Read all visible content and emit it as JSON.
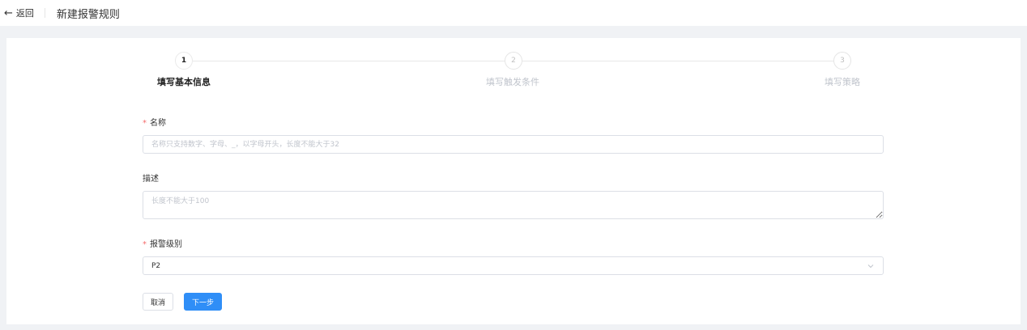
{
  "topbar": {
    "back_label": "返回",
    "title": "新建报警规则"
  },
  "steps": [
    {
      "number": "1",
      "label": "填写基本信息"
    },
    {
      "number": "2",
      "label": "填写触发条件"
    },
    {
      "number": "3",
      "label": "填写策略"
    }
  ],
  "form": {
    "name": {
      "label": "名称",
      "required": "*",
      "placeholder": "名称只支持数字、字母、_，以字母开头，长度不能大于32",
      "value": ""
    },
    "description": {
      "label": "描述",
      "placeholder": "长度不能大于100",
      "value": ""
    },
    "level": {
      "label": "报警级别",
      "required": "*",
      "value": "P2"
    }
  },
  "buttons": {
    "cancel": "取消",
    "next": "下一步"
  },
  "colors": {
    "primary": "#2f8ef7",
    "required": "#f56c6c",
    "background": "#f0f2f5"
  },
  "icons": {
    "back": "arrow-left-icon",
    "select": "chevron-down-icon"
  }
}
